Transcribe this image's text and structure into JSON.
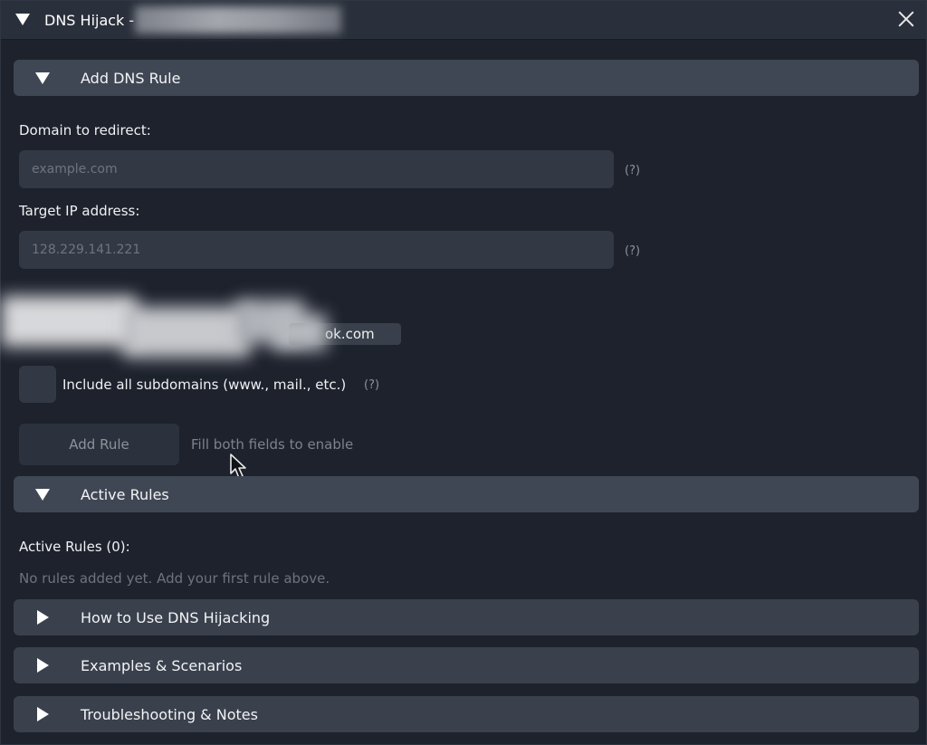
{
  "window": {
    "title": "DNS Hijack -"
  },
  "sections": {
    "add_rule": {
      "label": "Add DNS Rule"
    },
    "active_rules": {
      "label": "Active Rules"
    },
    "how_to": {
      "label": "How to Use DNS Hijacking"
    },
    "examples": {
      "label": "Examples & Scenarios"
    },
    "troubleshooting": {
      "label": "Troubleshooting & Notes"
    }
  },
  "form": {
    "domain_label": "Domain to redirect:",
    "domain_placeholder": "example.com",
    "target_label": "Target IP address:",
    "target_placeholder": "128.229.141.221",
    "help_marker": "(?)",
    "example_domain_visible": "ok.com",
    "subdomains_label": "Include all subdomains (www., mail., etc.)",
    "add_button_label": "Add Rule",
    "add_hint": "Fill both fields to enable"
  },
  "rules": {
    "count_label": "Active Rules (0):",
    "empty_message": "No rules added yet. Add your first rule above."
  }
}
